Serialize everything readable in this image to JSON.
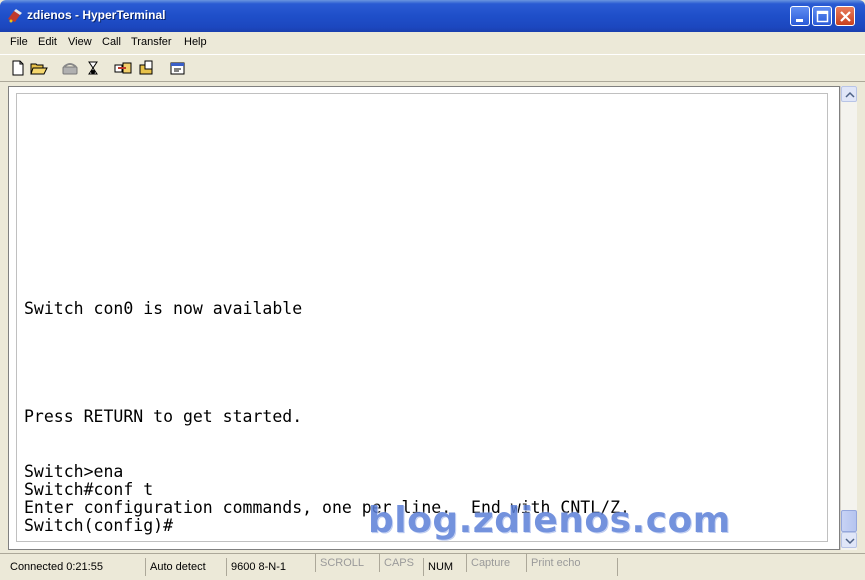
{
  "window": {
    "title": "zdienos - HyperTerminal"
  },
  "menu": [
    "File",
    "Edit",
    "View",
    "Call",
    "Transfer",
    "Help"
  ],
  "toolbar": [
    {
      "icon": "new-document-icon"
    },
    {
      "icon": "open-folder-icon"
    },
    {
      "icon": "call-phone-icon"
    },
    {
      "icon": "disconnect-icon"
    },
    {
      "icon": "send-file-icon"
    },
    {
      "icon": "receive-file-icon"
    },
    {
      "icon": "properties-icon"
    }
  ],
  "terminal": {
    "lines": [
      "Switch con0 is now available",
      "Press RETURN to get started.",
      "Switch>ena",
      "Switch#conf t",
      "Enter configuration commands, one per line.  End with CNTL/Z.",
      "Switch(config)#"
    ]
  },
  "watermark": "blog.zdienos.com",
  "status": {
    "connected": "Connected 0:21:55",
    "detect": "Auto detect",
    "settings": "9600 8-N-1",
    "scroll": "SCROLL",
    "caps": "CAPS",
    "num": "NUM",
    "capture": "Capture",
    "print_echo": "Print echo"
  },
  "colors": {
    "titlebar": "#1f4fc9",
    "watermark": "#5b7fd8"
  }
}
